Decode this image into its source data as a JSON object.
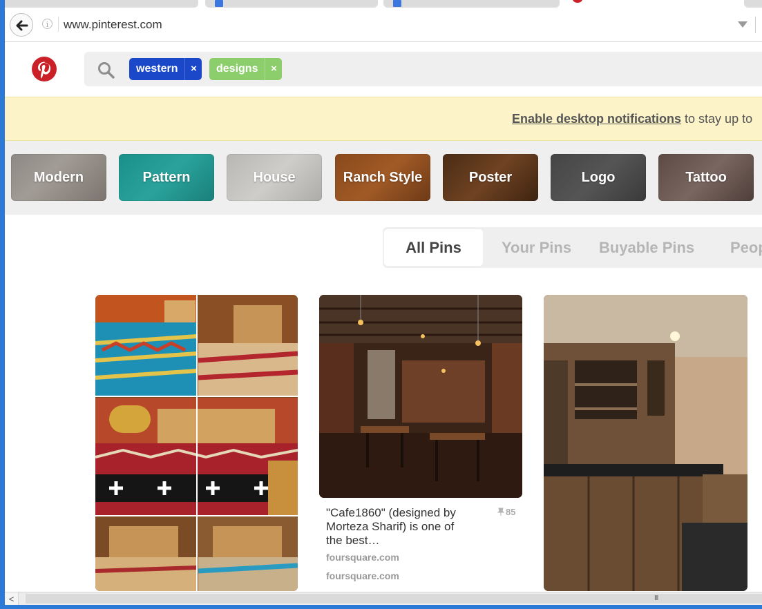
{
  "browser": {
    "url": "www.pinterest.com",
    "back_label": "Back",
    "info_label": "i"
  },
  "header": {
    "search_chips": [
      {
        "label": "western",
        "remove": "×",
        "color": "#1a48c8"
      },
      {
        "label": "designs",
        "remove": "×",
        "color": "#8ccd6c"
      }
    ],
    "brand_color": "#cb2027"
  },
  "notification": {
    "link_text": "Enable desktop notifications",
    "rest_text": " to stay up to"
  },
  "guides": [
    "Modern",
    "Pattern",
    "House",
    "Ranch Style",
    "Poster",
    "Logo",
    "Tattoo"
  ],
  "filter_tabs": [
    "All Pins",
    "Your Pins",
    "Buyable Pins",
    "Peop"
  ],
  "pins": [
    {
      "kind": "bedroom-collage"
    },
    {
      "kind": "cafe-interior",
      "description": "\"Cafe1860\" (designed by Morteza Sharif) is one of the best…",
      "save_count": "85",
      "sources": [
        "foursquare.com",
        "foursquare.com"
      ]
    },
    {
      "kind": "rustic-kitchen"
    }
  ],
  "scrollbar": {
    "left_arrow": "<",
    "grip": "III"
  }
}
